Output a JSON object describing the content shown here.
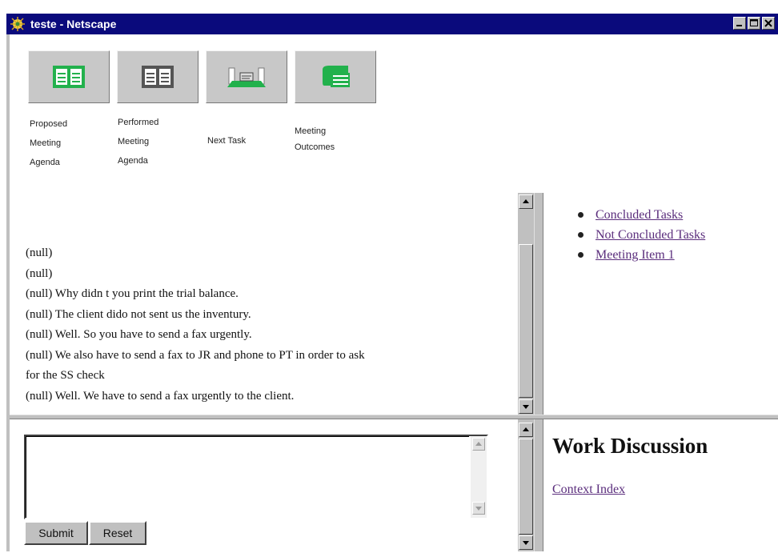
{
  "window": {
    "title": "teste - Netscape"
  },
  "toolbar": {
    "buttons": [
      {
        "icon": "proposed-agenda-icon",
        "label_lines": [
          "Proposed",
          "Meeting",
          "Agenda"
        ]
      },
      {
        "icon": "performed-agenda-icon",
        "label_lines": [
          "Performed",
          "Meeting",
          "Agenda"
        ]
      },
      {
        "icon": "next-task-icon",
        "label_lines": [
          "Next Task"
        ]
      },
      {
        "icon": "meeting-outcomes-icon",
        "label_lines": [
          "Meeting",
          "Outcomes"
        ]
      }
    ]
  },
  "chat": {
    "lines": [
      "(null)",
      "(null)",
      "(null) Why didn t you print the trial balance.",
      "(null) The client dido not sent us the inventury.",
      "(null) Well. So you have to send a fax urgently.",
      "(null) We also have to send a fax to JR and phone to PT in order to ask",
      "for the SS check",
      "(null) Well. We have to send a fax urgently to the client."
    ]
  },
  "task_links": [
    "Concluded Tasks",
    "Not Concluded Tasks",
    "Meeting Item 1"
  ],
  "form": {
    "message_value": "",
    "submit_label": "Submit",
    "reset_label": "Reset"
  },
  "discussion": {
    "heading": "Work Discussion",
    "context_link": "Context Index"
  },
  "colors": {
    "titlebar": "#0a0a7c",
    "chrome": "#c0c0c0",
    "link_visited": "#5a2d7c",
    "icon_green": "#22b14c"
  }
}
